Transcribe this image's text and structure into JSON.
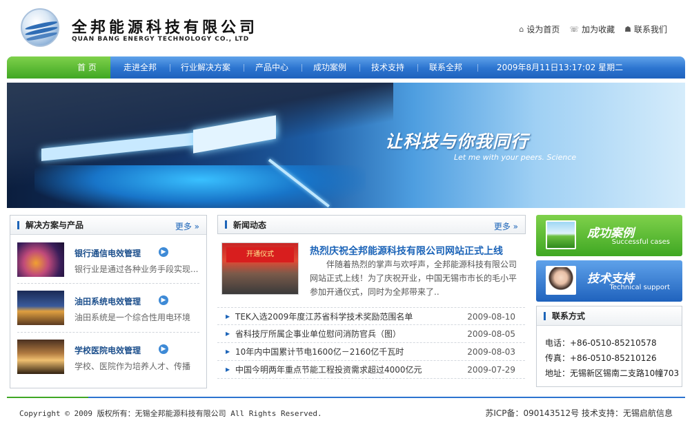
{
  "header": {
    "brand_cn": "全邦能源科技有限公司",
    "brand_en": "QUAN BANG ENERGY TECHNOLOGY CO., LTD",
    "links": [
      {
        "label": "设为首页",
        "icon": "home-icon"
      },
      {
        "label": "加为收藏",
        "icon": "favorite-icon"
      },
      {
        "label": "联系我们",
        "icon": "contact-icon"
      }
    ]
  },
  "nav": {
    "items": [
      "首 页",
      "走进全邦",
      "行业解决方案",
      "产品中心",
      "成功案例",
      "技术支持",
      "联系全邦"
    ],
    "datetime": "2009年8月11日13:17:02 星期二"
  },
  "banner": {
    "slogan": "让科技与你我同行",
    "slogan_en": "Let me with your peers. Science"
  },
  "products": {
    "title": "解决方案与产品",
    "more": "更多 »",
    "items": [
      {
        "name": "银行通信电效管理",
        "desc": "银行业是通过各种业务手段实现..."
      },
      {
        "name": "油田系统电效管理",
        "desc": "油田系统是一个综合性用电环境"
      },
      {
        "name": "学校医院电效管理",
        "desc": "学校、医院作为培养人才、传播"
      }
    ]
  },
  "news": {
    "title": "新闻动态",
    "more": "更多 »",
    "headline": {
      "title": "热烈庆祝全邦能源科技有限公司网站正式上线",
      "text": "伴随着热烈的掌声与欢呼声，全邦能源科技有限公司网站正式上线！为了庆祝开业，中国无锡市市长的毛小平参加开通仪式，同时为全邦带来了..",
      "image_text": "开通仪式"
    },
    "items": [
      {
        "title": "TEK入选2009年度江苏省科学技术奖励范围名单",
        "date": "2009-08-10"
      },
      {
        "title": "省科技厅所属企事业单位慰问消防官兵（图）",
        "date": "2009-08-05"
      },
      {
        "title": "10年内中国累计节电1600亿－2160亿千瓦时",
        "date": "2009-08-03"
      },
      {
        "title": "中国今明两年重点节能工程投资需求超过4000亿元",
        "date": "2009-07-29"
      }
    ]
  },
  "promos": [
    {
      "cn": "成功案例",
      "en": "Successful cases",
      "color": "#4fb52b"
    },
    {
      "cn": "技术支持",
      "en": "Technical support",
      "color": "#2b73cf"
    }
  ],
  "contact": {
    "title": "联系方式",
    "phone": "电话：+86-0510-85210578",
    "fax": "传真：+86-0510-85210126",
    "address": "地址：无锡新区锡南二支路10幢703"
  },
  "footer": {
    "copyright": "Copyright © 2009 版权所有：无锡全邦能源科技有限公司 All Rights Reserved.",
    "icp": "苏ICP备：090143512号  技术支持：无锡启航信息"
  }
}
